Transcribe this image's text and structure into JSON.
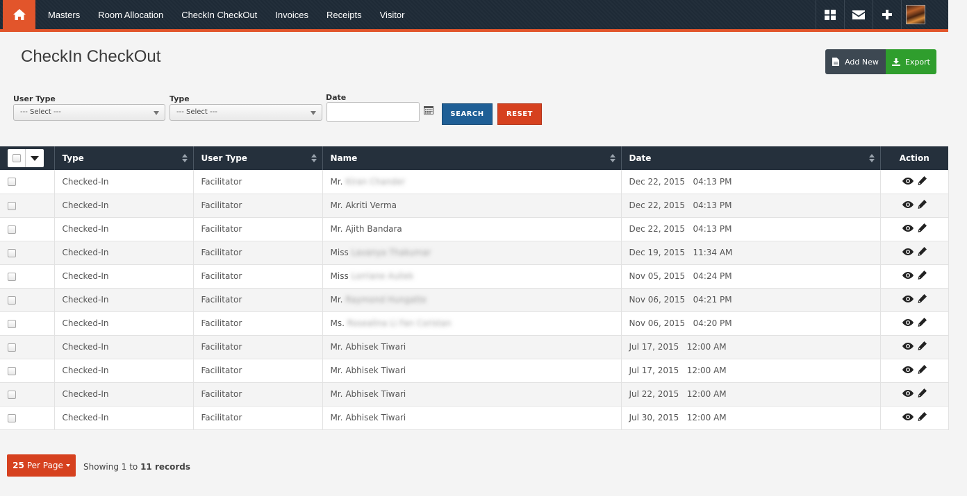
{
  "nav": {
    "links": [
      "Masters",
      "Room Allocation",
      "CheckIn CheckOut",
      "Invoices",
      "Receipts",
      "Visitor"
    ]
  },
  "page": {
    "title": "CheckIn CheckOut"
  },
  "actions": {
    "add_new": "Add New",
    "export": "Export"
  },
  "filters": {
    "user_type_label": "User Type",
    "user_type_value": "--- Select ---",
    "type_label": "Type",
    "type_value": "--- Select ---",
    "date_label": "Date",
    "date_value": "",
    "search": "SEARCH",
    "reset": "RESET"
  },
  "table": {
    "headers": [
      "Type",
      "User Type",
      "Name",
      "Date",
      "Action"
    ],
    "rows": [
      {
        "type": "Checked-In",
        "user_type": "Facilitator",
        "name_prefix": "Mr.",
        "name": "Kiran Chander",
        "blurred": true,
        "date": "Dec 22, 2015",
        "time": "04:13 PM"
      },
      {
        "type": "Checked-In",
        "user_type": "Facilitator",
        "name_prefix": "Mr.",
        "name": "Akriti Verma",
        "blurred": false,
        "date": "Dec 22, 2015",
        "time": "04:13 PM"
      },
      {
        "type": "Checked-In",
        "user_type": "Facilitator",
        "name_prefix": "Mr.",
        "name": "Ajith Bandara",
        "blurred": false,
        "date": "Dec 22, 2015",
        "time": "04:13 PM"
      },
      {
        "type": "Checked-In",
        "user_type": "Facilitator",
        "name_prefix": "Miss",
        "name": "Lavanya Thakumar",
        "blurred": true,
        "date": "Dec 19, 2015",
        "time": "11:34 AM"
      },
      {
        "type": "Checked-In",
        "user_type": "Facilitator",
        "name_prefix": "Miss",
        "name": "Lorriane Auliek",
        "blurred": true,
        "date": "Nov 05, 2015",
        "time": "04:24 PM"
      },
      {
        "type": "Checked-In",
        "user_type": "Facilitator",
        "name_prefix": "Mr.",
        "name": "Raymond Hungatte",
        "blurred": true,
        "date": "Nov 06, 2015",
        "time": "04:21 PM"
      },
      {
        "type": "Checked-In",
        "user_type": "Facilitator",
        "name_prefix": "Ms.",
        "name": "Rosealina Li Fan Coristan",
        "blurred": true,
        "date": "Nov 06, 2015",
        "time": "04:20 PM"
      },
      {
        "type": "Checked-In",
        "user_type": "Facilitator",
        "name_prefix": "Mr.",
        "name": "Abhisek Tiwari",
        "blurred": false,
        "date": "Jul 17, 2015",
        "time": "12:00 AM"
      },
      {
        "type": "Checked-In",
        "user_type": "Facilitator",
        "name_prefix": "Mr.",
        "name": "Abhisek Tiwari",
        "blurred": false,
        "date": "Jul 17, 2015",
        "time": "12:00 AM"
      },
      {
        "type": "Checked-In",
        "user_type": "Facilitator",
        "name_prefix": "Mr.",
        "name": "Abhisek Tiwari",
        "blurred": false,
        "date": "Jul 22, 2015",
        "time": "12:00 AM"
      },
      {
        "type": "Checked-In",
        "user_type": "Facilitator",
        "name_prefix": "Mr.",
        "name": "Abhisek Tiwari",
        "blurred": false,
        "date": "Jul 30, 2015",
        "time": "12:00 AM"
      }
    ]
  },
  "pagination": {
    "per_page_count": "25",
    "per_page_label": "Per Page",
    "showing_prefix": "Showing 1 to",
    "showing_count": "11 records"
  },
  "icons": {
    "home": "home-icon",
    "dashboard": "grid-icon",
    "mail": "envelope-icon",
    "add": "plus-icon",
    "view": "eye-icon",
    "edit": "pencil-icon",
    "calendar": "calendar-icon"
  },
  "colors": {
    "navbar": "#1e2a36",
    "accent": "#e2552b",
    "search": "#1f5f96",
    "reset": "#d6411f",
    "export": "#2f9e2d"
  }
}
